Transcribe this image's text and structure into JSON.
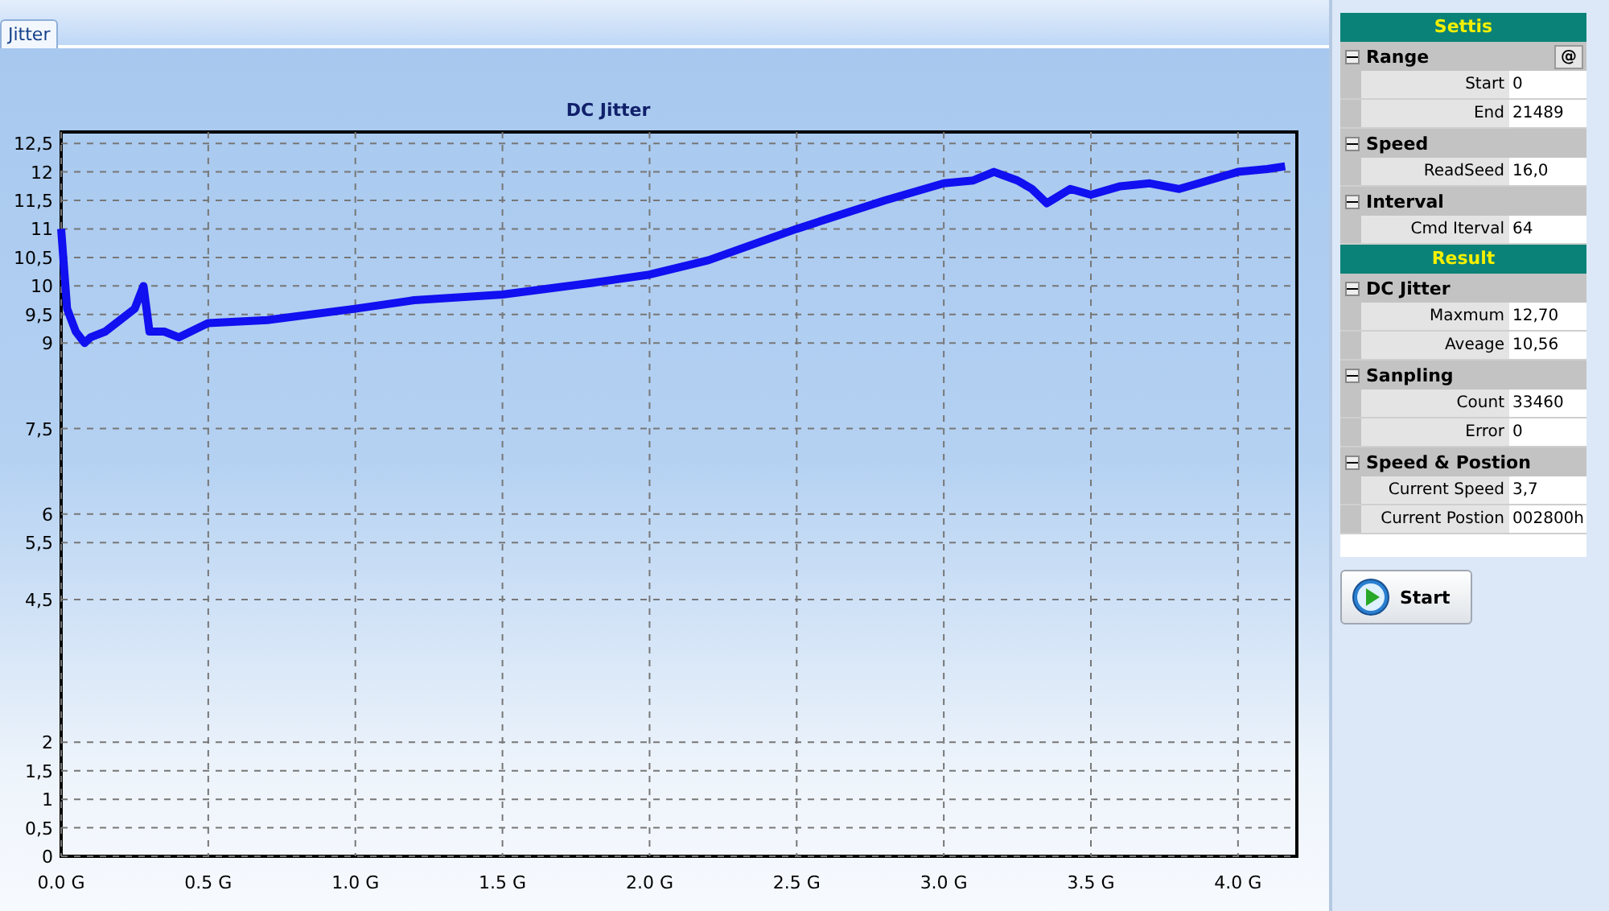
{
  "tabs": [
    {
      "label": "Jitter",
      "selected": true
    }
  ],
  "chart": {
    "chart_data": {
      "type": "line",
      "title": "DC Jitter",
      "x": [
        0,
        0.02,
        0.05,
        0.08,
        0.1,
        0.15,
        0.2,
        0.25,
        0.28,
        0.3,
        0.35,
        0.4,
        0.5,
        0.7,
        1.0,
        1.2,
        1.5,
        1.8,
        2.0,
        2.2,
        2.5,
        2.8,
        3.0,
        3.1,
        3.17,
        3.25,
        3.3,
        3.35,
        3.43,
        3.5,
        3.6,
        3.7,
        3.8,
        3.9,
        4.0,
        4.1,
        4.16
      ],
      "series": [
        {
          "color": "#1010f0",
          "values": [
            11.0,
            9.6,
            9.2,
            9.0,
            9.1,
            9.2,
            9.4,
            9.6,
            10.0,
            9.2,
            9.2,
            9.1,
            9.35,
            9.4,
            9.6,
            9.75,
            9.85,
            10.05,
            10.2,
            10.45,
            11.0,
            11.5,
            11.8,
            11.85,
            12.0,
            11.85,
            11.7,
            11.45,
            11.7,
            11.6,
            11.75,
            11.8,
            11.7,
            11.85,
            12.0,
            12.05,
            12.1
          ]
        }
      ],
      "grid": true,
      "xlim": [
        0,
        4.2
      ],
      "ylim": [
        0,
        12.7
      ],
      "xticks": [
        {
          "value": 0,
          "label": "0.0 G"
        },
        {
          "value": 0.5,
          "label": "0.5 G"
        },
        {
          "value": 1,
          "label": "1.0 G"
        },
        {
          "value": 1.5,
          "label": "1.5 G"
        },
        {
          "value": 2,
          "label": "2.0 G"
        },
        {
          "value": 2.5,
          "label": "2.5 G"
        },
        {
          "value": 3,
          "label": "3.0 G"
        },
        {
          "value": 3.5,
          "label": "3.5 G"
        },
        {
          "value": 4,
          "label": "4.0 G"
        }
      ],
      "yticks": [
        {
          "value": 12.5,
          "label": "12,5"
        },
        {
          "value": 12,
          "label": "12"
        },
        {
          "value": 11.5,
          "label": "11,5"
        },
        {
          "value": 11,
          "label": "11"
        },
        {
          "value": 10.5,
          "label": "10,5"
        },
        {
          "value": 10,
          "label": "10"
        },
        {
          "value": 9.5,
          "label": "9,5"
        },
        {
          "value": 9,
          "label": "9"
        },
        {
          "value": 7.5,
          "label": "7,5"
        },
        {
          "value": 6,
          "label": "6"
        },
        {
          "value": 5.5,
          "label": "5,5"
        },
        {
          "value": 4.5,
          "label": "4,5"
        },
        {
          "value": 2,
          "label": "2"
        },
        {
          "value": 1.5,
          "label": "1,5"
        },
        {
          "value": 1,
          "label": "1"
        },
        {
          "value": 0.5,
          "label": "0,5"
        },
        {
          "value": 0,
          "label": "0"
        }
      ]
    }
  },
  "panel": {
    "sections": [
      {
        "kind": "header",
        "title": "Settis"
      },
      {
        "kind": "group",
        "title": "Range",
        "expanded": true,
        "button": "@",
        "rows": [
          {
            "label": "Start",
            "value": "0"
          },
          {
            "label": "End",
            "value": "21489"
          }
        ]
      },
      {
        "kind": "group",
        "title": "Speed",
        "expanded": true,
        "rows": [
          {
            "label": "ReadSeed",
            "value": "16,0"
          }
        ]
      },
      {
        "kind": "group",
        "title": "Interval",
        "expanded": true,
        "rows": [
          {
            "label": "Cmd Iterval",
            "value": "64"
          }
        ]
      },
      {
        "kind": "header",
        "title": "Result"
      },
      {
        "kind": "group",
        "title": "DC Jitter",
        "expanded": true,
        "rows": [
          {
            "label": "Maxmum",
            "value": "12,70"
          },
          {
            "label": "Aveage",
            "value": "10,56"
          }
        ]
      },
      {
        "kind": "group",
        "title": "Sanpling",
        "expanded": true,
        "rows": [
          {
            "label": "Count",
            "value": "33460"
          },
          {
            "label": "Error",
            "value": "0"
          }
        ]
      },
      {
        "kind": "group",
        "title": "Speed & Postion",
        "expanded": true,
        "rows": [
          {
            "label": "Current Speed",
            "value": "3,7"
          },
          {
            "label": "Current Postion",
            "value": "002800h"
          }
        ]
      }
    ],
    "start_button": "Start"
  }
}
